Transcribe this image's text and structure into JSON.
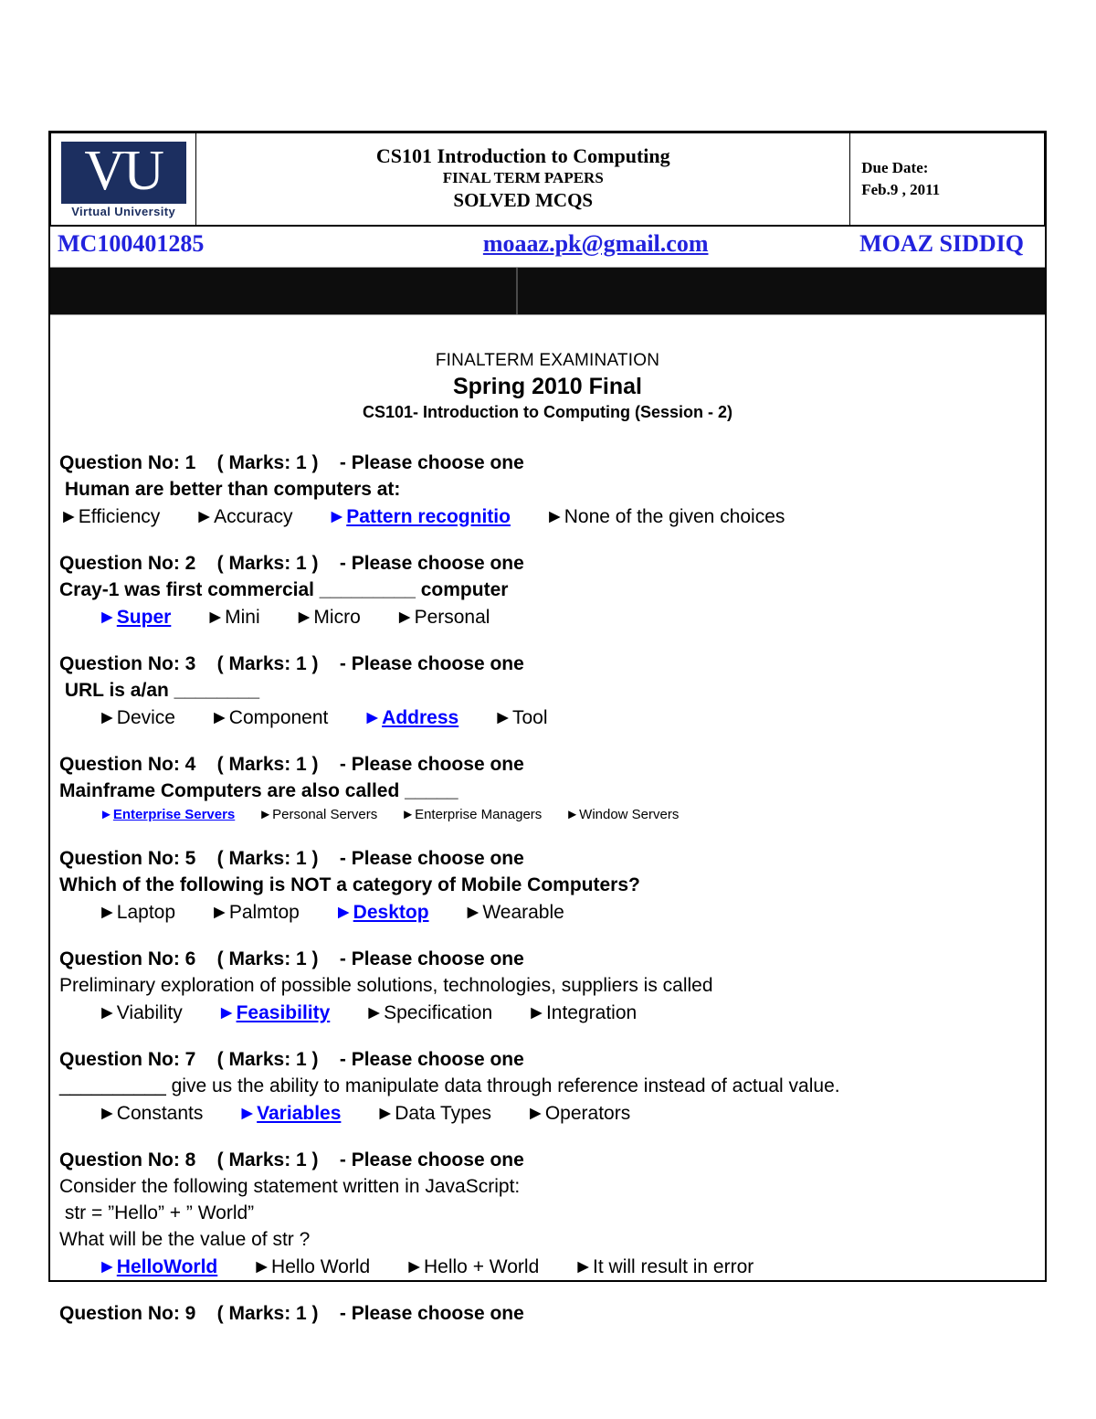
{
  "header": {
    "logo": {
      "mark": "VU",
      "caption": "Virtual University"
    },
    "course_title": "CS101 Introduction to Computing",
    "paper_type": "FINAL TERM PAPERS",
    "paper_kind": "SOLVED MCQS",
    "due_label": "Due Date:",
    "due_date": "Feb.9 , 2011",
    "student_id": "MC100401285",
    "email": "moaaz.pk@gmail.com",
    "author": "MOAZ SIDDIQ"
  },
  "exam": {
    "line1": "FINALTERM EXAMINATION",
    "line2": "Spring 2010 Final",
    "line3": "CS101- Introduction to Computing (Session - 2)"
  },
  "colors": {
    "correct": "#0000FF",
    "header_text": "#2222DD",
    "logo_navy": "#1C2F60",
    "band": "#0D0D0D"
  },
  "bullet": "►",
  "questions": [
    {
      "head": "Question No: 1    ( Marks: 1 )    - Please choose one",
      "stem": " Human are better than computers at:",
      "stem_bold": true,
      "indent": "flush",
      "size": "normal",
      "options": [
        {
          "label": "Efficiency",
          "correct": false
        },
        {
          "label": "Accuracy",
          "correct": false
        },
        {
          "label": "Pattern recognitio",
          "correct": true
        },
        {
          "label": "None of the given choices",
          "correct": false
        }
      ]
    },
    {
      "head": "Question No: 2    ( Marks: 1 )    - Please choose one",
      "stem": "Cray-1 was first commercial _________ computer",
      "stem_bold": true,
      "indent": "indent",
      "size": "normal",
      "options": [
        {
          "label": "Super",
          "correct": true
        },
        {
          "label": "Mini",
          "correct": false
        },
        {
          "label": "Micro",
          "correct": false
        },
        {
          "label": "Personal",
          "correct": false
        }
      ]
    },
    {
      "head": "Question No: 3    ( Marks: 1 )    - Please choose one",
      "stem": " URL is a/an ________",
      "stem_bold": true,
      "indent": "indent",
      "size": "normal",
      "options": [
        {
          "label": "Device",
          "correct": false
        },
        {
          "label": "Component",
          "correct": false
        },
        {
          "label": "Address",
          "correct": true
        },
        {
          "label": "Tool",
          "correct": false
        }
      ]
    },
    {
      "head": "Question No: 4    ( Marks: 1 )    - Please choose one",
      "stem": "Mainframe Computers are also called _____",
      "stem_bold": true,
      "indent": "indent-sm",
      "size": "small",
      "options": [
        {
          "label": "Enterprise Servers",
          "correct": true
        },
        {
          "label": "Personal Servers",
          "correct": false
        },
        {
          "label": "Enterprise Managers",
          "correct": false
        },
        {
          "label": "Window Servers",
          "correct": false
        }
      ]
    },
    {
      "head": "Question No: 5    ( Marks: 1 )    - Please choose one",
      "stem": "Which of the following is NOT a category of Mobile Computers?",
      "stem_bold": true,
      "indent": "indent",
      "size": "normal",
      "options": [
        {
          "label": "Laptop",
          "correct": false
        },
        {
          "label": "Palmtop",
          "correct": false
        },
        {
          "label": "Desktop",
          "correct": true
        },
        {
          "label": "Wearable",
          "correct": false
        }
      ]
    },
    {
      "head": "Question No: 6    ( Marks: 1 )    - Please choose one",
      "stem": "Preliminary exploration of possible solutions, technologies, suppliers is called",
      "stem_bold": false,
      "indent": "indent",
      "size": "normal",
      "options": [
        {
          "label": "Viability",
          "correct": false
        },
        {
          "label": "Feasibility",
          "correct": true
        },
        {
          "label": "Specification",
          "correct": false
        },
        {
          "label": "Integration",
          "correct": false
        }
      ]
    },
    {
      "head": "Question No: 7    ( Marks: 1 )    - Please choose one",
      "stem": "__________ give us the ability to manipulate data through reference instead of actual value.",
      "stem_bold": false,
      "indent": "indent",
      "size": "normal",
      "options": [
        {
          "label": "Constants",
          "correct": false
        },
        {
          "label": "Variables",
          "correct": true
        },
        {
          "label": "Data Types",
          "correct": false
        },
        {
          "label": "Operators",
          "correct": false
        }
      ]
    },
    {
      "head": "Question No: 8    ( Marks: 1 )    - Please choose one",
      "stem": "Consider the following statement written in JavaScript:\n str = ”Hello” + ” World”\nWhat will be the value of str ?",
      "stem_bold": false,
      "indent": "indent",
      "size": "normal",
      "options": [
        {
          "label": "HelloWorld ",
          "correct": true
        },
        {
          "label": "Hello World",
          "correct": false
        },
        {
          "label": "Hello + World",
          "correct": false
        },
        {
          "label": "It will result in error",
          "correct": false
        }
      ]
    },
    {
      "head": "Question No: 9    ( Marks: 1 )    - Please choose one",
      "stem": "",
      "stem_bold": true,
      "indent": "flush",
      "size": "normal",
      "options": []
    }
  ]
}
